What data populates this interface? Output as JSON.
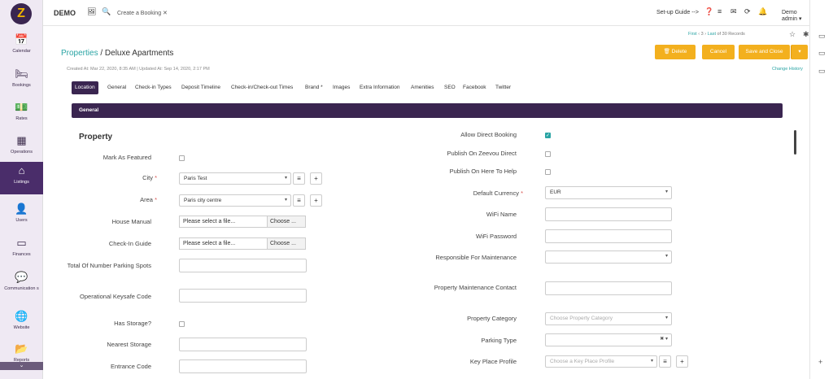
{
  "app": {
    "logo_letter": "Z"
  },
  "sidebar": {
    "items": [
      {
        "label": "Calendar",
        "icon": "calendar-icon",
        "glyph": "📅"
      },
      {
        "label": "Bookings",
        "icon": "bed-icon",
        "glyph": "🛏"
      },
      {
        "label": "Rates",
        "icon": "money-icon",
        "glyph": "💵"
      },
      {
        "label": "Operations",
        "icon": "grid-icon",
        "glyph": "▦"
      },
      {
        "label": "Listings",
        "icon": "home-icon",
        "glyph": "⌂"
      },
      {
        "label": "Users",
        "icon": "user-icon",
        "glyph": "👤"
      },
      {
        "label": "Finances",
        "icon": "credit-card-icon",
        "glyph": "▭"
      },
      {
        "label": "Communication s",
        "icon": "chat-icon",
        "glyph": "💬"
      },
      {
        "label": "Website",
        "icon": "globe-icon",
        "glyph": "🌐"
      },
      {
        "label": "Reports",
        "icon": "folder-icon",
        "glyph": "📂"
      }
    ],
    "scroll_glyph": "⌄"
  },
  "topbar": {
    "demo": "DEMO",
    "tab_label": "Create a Booking ✕",
    "setup": "Set-up Guide -->",
    "admin": "Demo admin ▾"
  },
  "page": {
    "crumb_link": "Properties",
    "crumb_sep": " / ",
    "title": "Deluxe Apartments",
    "meta": "Created At: Mar 22, 2020, 8:35 AM  |  Updated At: Sep 14, 2020, 2:17 PM",
    "change_history": "Change History"
  },
  "pager": {
    "first": "First",
    "page": "3",
    "last": "Last",
    "records": "of 30 Records"
  },
  "buttons": {
    "delete": "🗑 Delete",
    "cancel": "Cancel",
    "save_close": "Save and Close",
    "caret": "▾"
  },
  "tabs": [
    "Location",
    "General",
    "Check-in Types",
    "Deposit Timeline",
    "Check-in/Check-out Times",
    "Brand *",
    "Images",
    "Extra Information",
    "Amenities",
    "SEO",
    "Facebook",
    "Twitter"
  ],
  "general_header": "General",
  "section_title": "Property",
  "left_fields": {
    "featured": "Mark As Featured",
    "city": "City",
    "city_value": "Paris Test",
    "area": "Area",
    "area_value": "Paris city centre",
    "house_manual": "House Manual",
    "checkin_guide": "Check-In Guide",
    "file_placeholder": "Please select a file...",
    "choose": "Choose ...",
    "parking": "Total Of Number Parking Spots",
    "keysafe": "Operational Keysafe Code",
    "has_storage": "Has Storage?",
    "nearest_storage": "Nearest Storage",
    "entrance": "Entrance Code",
    "required_mark": "*"
  },
  "right_fields": {
    "direct": "Allow Direct Booking",
    "zeevou": "Publish On Zeevou Direct",
    "heretohelp": "Publish On Here To Help",
    "currency": "Default Currency",
    "currency_value": "EUR",
    "wifi_name": "WiFi Name",
    "wifi_pass": "WiFi Password",
    "responsible": "Responsible For Maintenance",
    "maint_contact": "Property Maintenance Contact",
    "category": "Property Category",
    "category_ph": "Choose Property Category",
    "parking_type": "Parking Type",
    "key_place": "Key Place Profile",
    "key_place_ph": "Choose a Key Place Profile"
  },
  "colors": {
    "accent": "#f3b01e",
    "brand": "#3a2550",
    "link": "#2aa4a4"
  }
}
